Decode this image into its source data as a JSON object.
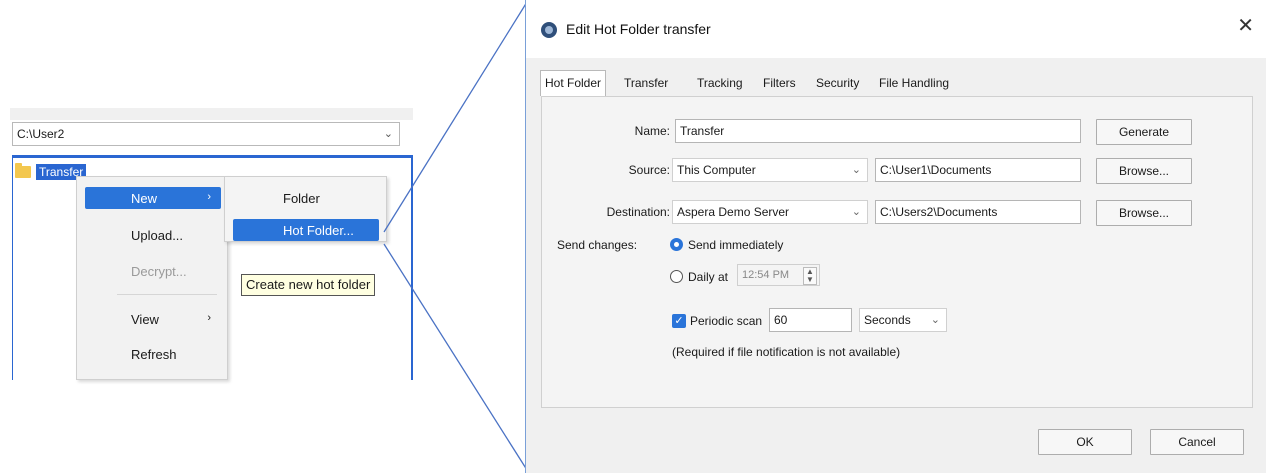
{
  "explorer": {
    "path_value": "C:\\User2",
    "tree_item": "Transfer"
  },
  "context_menu": {
    "items": [
      {
        "label": "New",
        "arrow": "›"
      },
      {
        "label": "Upload..."
      },
      {
        "label": "Decrypt..."
      },
      {
        "label": "View",
        "arrow": "›"
      },
      {
        "label": "Refresh"
      }
    ]
  },
  "submenu": {
    "items": [
      {
        "label": "Folder"
      },
      {
        "label": "Hot Folder..."
      }
    ]
  },
  "tooltip": "Create new hot folder",
  "dialog": {
    "title": "Edit Hot Folder transfer",
    "close": "✕",
    "tabs": [
      "Hot Folder",
      "Transfer",
      "Tracking",
      "Filters",
      "Security",
      "File Handling"
    ],
    "name_label": "Name:",
    "name_value": "Transfer",
    "generate_label": "Generate",
    "source_label": "Source:",
    "source_select": "This Computer",
    "source_path": "C:\\User1\\Documents",
    "browse_label": "Browse...",
    "destination_label": "Destination:",
    "destination_select": "Aspera Demo Server",
    "destination_path": "C:\\Users2\\Documents",
    "send_changes_label": "Send changes:",
    "send_immediately": "Send immediately",
    "daily_at": "Daily at",
    "daily_time": "12:54 PM",
    "periodic_scan": "Periodic scan",
    "scan_value": "60",
    "scan_unit": "Seconds",
    "scan_note": "(Required if file notification is not available)",
    "ok_label": "OK",
    "cancel_label": "Cancel"
  },
  "colors": {
    "accent": "#2a74d9",
    "tooltip_bg": "#ffffe1",
    "connector": "#4a72c4"
  }
}
